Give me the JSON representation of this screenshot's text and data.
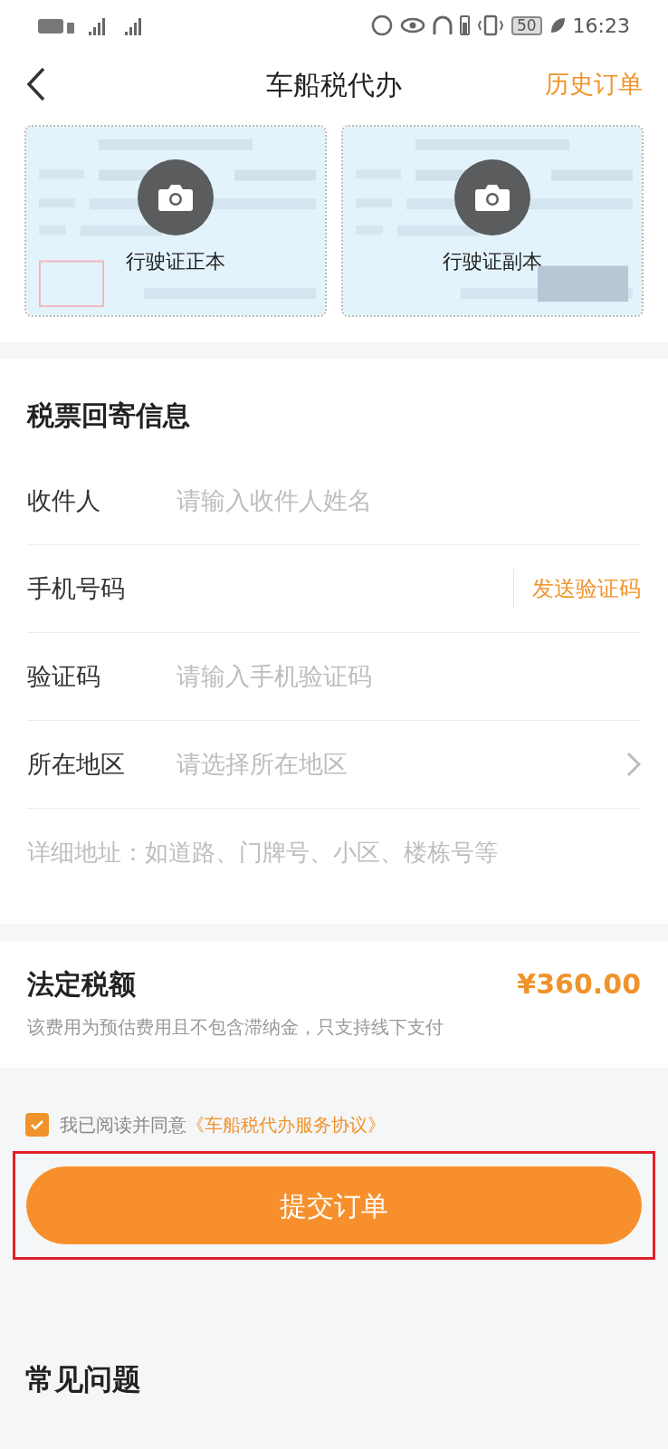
{
  "status_bar": {
    "battery": "50",
    "time": "16:23"
  },
  "nav": {
    "title": "车船税代办",
    "action": "历史订单"
  },
  "license_photos": [
    {
      "kind": "picture",
      "label": "行驶证正本"
    },
    {
      "kind": "picture",
      "label": "行驶证副本"
    }
  ],
  "mail_info": {
    "title": "税票回寄信息",
    "fields": [
      {
        "kind": "input",
        "label": "收件人",
        "placeholder": "请输入收件人姓名"
      },
      {
        "kind": "phone",
        "label": "手机号码",
        "action": "发送验证码"
      },
      {
        "kind": "input",
        "label": "验证码",
        "placeholder": "请输入手机验证码"
      },
      {
        "kind": "select",
        "label": "所在地区",
        "placeholder": "请选择所在地区"
      },
      {
        "kind": "textarea",
        "placeholder": "详细地址：如道路、门牌号、小区、楼栋号等"
      }
    ]
  },
  "tax": {
    "title": "法定税额",
    "amount": "¥360.00",
    "note": "该费用为预估费用且不包含滞纳金，只支持线下支付"
  },
  "agreement": {
    "checked": true,
    "text": "我已阅读并同意",
    "link": "《车船税代办服务协议》"
  },
  "submit": "提交订单",
  "faq": {
    "title": "常见问题"
  }
}
